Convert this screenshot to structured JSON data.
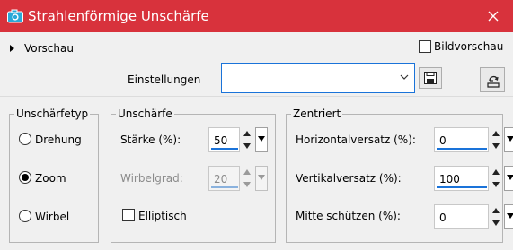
{
  "window": {
    "title": "Strahlenförmige Unschärfe",
    "icon": "camera-icon",
    "accent": "#d8323c"
  },
  "toolbar": {
    "preview_label": "Vorschau",
    "bildvorschau_label": "Bildvorschau",
    "bildvorschau_checked": false,
    "settings_label": "Einstellungen",
    "settings_value": ""
  },
  "group_type": {
    "title": "Unschärfetyp",
    "options": [
      {
        "label": "Drehung",
        "selected": false
      },
      {
        "label": "Zoom",
        "selected": true
      },
      {
        "label": "Wirbel",
        "selected": false
      }
    ]
  },
  "group_blur": {
    "title": "Unschärfe",
    "strength": {
      "label": "Stärke (%):",
      "value": "50"
    },
    "twist": {
      "label": "Wirbelgrad:",
      "value": "20",
      "disabled": true
    },
    "elliptic": {
      "label": "Elliptisch",
      "checked": false
    }
  },
  "group_center": {
    "title": "Zentriert",
    "h_offset": {
      "label": "Horizontalversatz (%):",
      "value": "0"
    },
    "v_offset": {
      "label": "Vertikalversatz (%):",
      "value": "100"
    },
    "protect": {
      "label": "Mitte schützen (%):",
      "value": "0"
    }
  }
}
